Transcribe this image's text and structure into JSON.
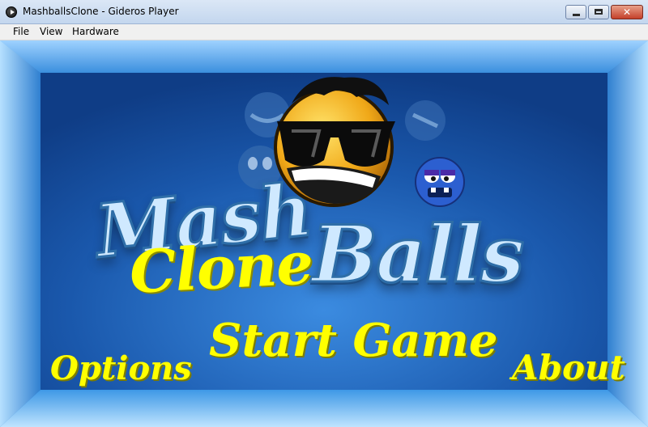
{
  "window": {
    "title": "MashballsClone - Gideros Player",
    "minimize_label": "",
    "maximize_label": "",
    "close_label": "✕"
  },
  "menu": {
    "file": "File",
    "view": "View",
    "hardware": "Hardware"
  },
  "game": {
    "logo_word_1": "Mash",
    "logo_word_2": "Balls",
    "logo_subtitle": "Clone",
    "start_label": "Start Game",
    "options_label": "Options",
    "about_label": "About"
  },
  "icons": [
    "app-play-icon",
    "minimize-icon",
    "maximize-icon",
    "close-icon",
    "sunglasses-ball-mascot",
    "blue-ball-character"
  ],
  "colors": {
    "menu_text": "#ffff00",
    "logo_fill": "#cfe9ff",
    "background_top": "#6eb6f0",
    "background_bottom": "#1b76cf",
    "inner_panel": "#1d5fb3"
  }
}
